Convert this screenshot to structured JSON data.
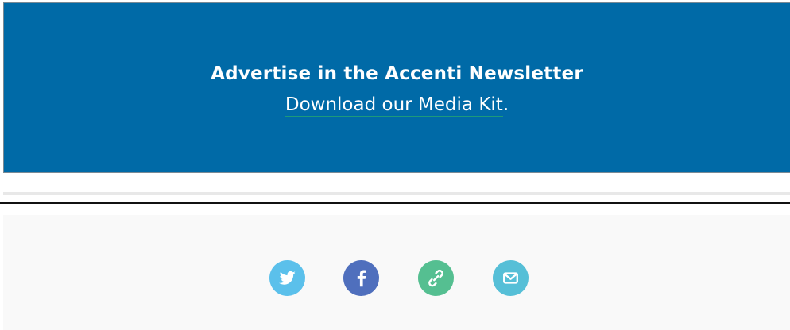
{
  "ad_banner": {
    "title": "Advertise in the Accenti Newsletter",
    "link_text": "Download our Media Kit",
    "link_suffix": ".",
    "background_color": "#006aa7"
  },
  "share": {
    "buttons": [
      {
        "icon": "twitter-icon",
        "color": "#5bc0eb"
      },
      {
        "icon": "facebook-icon",
        "color": "#4f6fbd"
      },
      {
        "icon": "link-icon",
        "color": "#55bf91"
      },
      {
        "icon": "email-icon",
        "color": "#56bfd7"
      }
    ]
  }
}
